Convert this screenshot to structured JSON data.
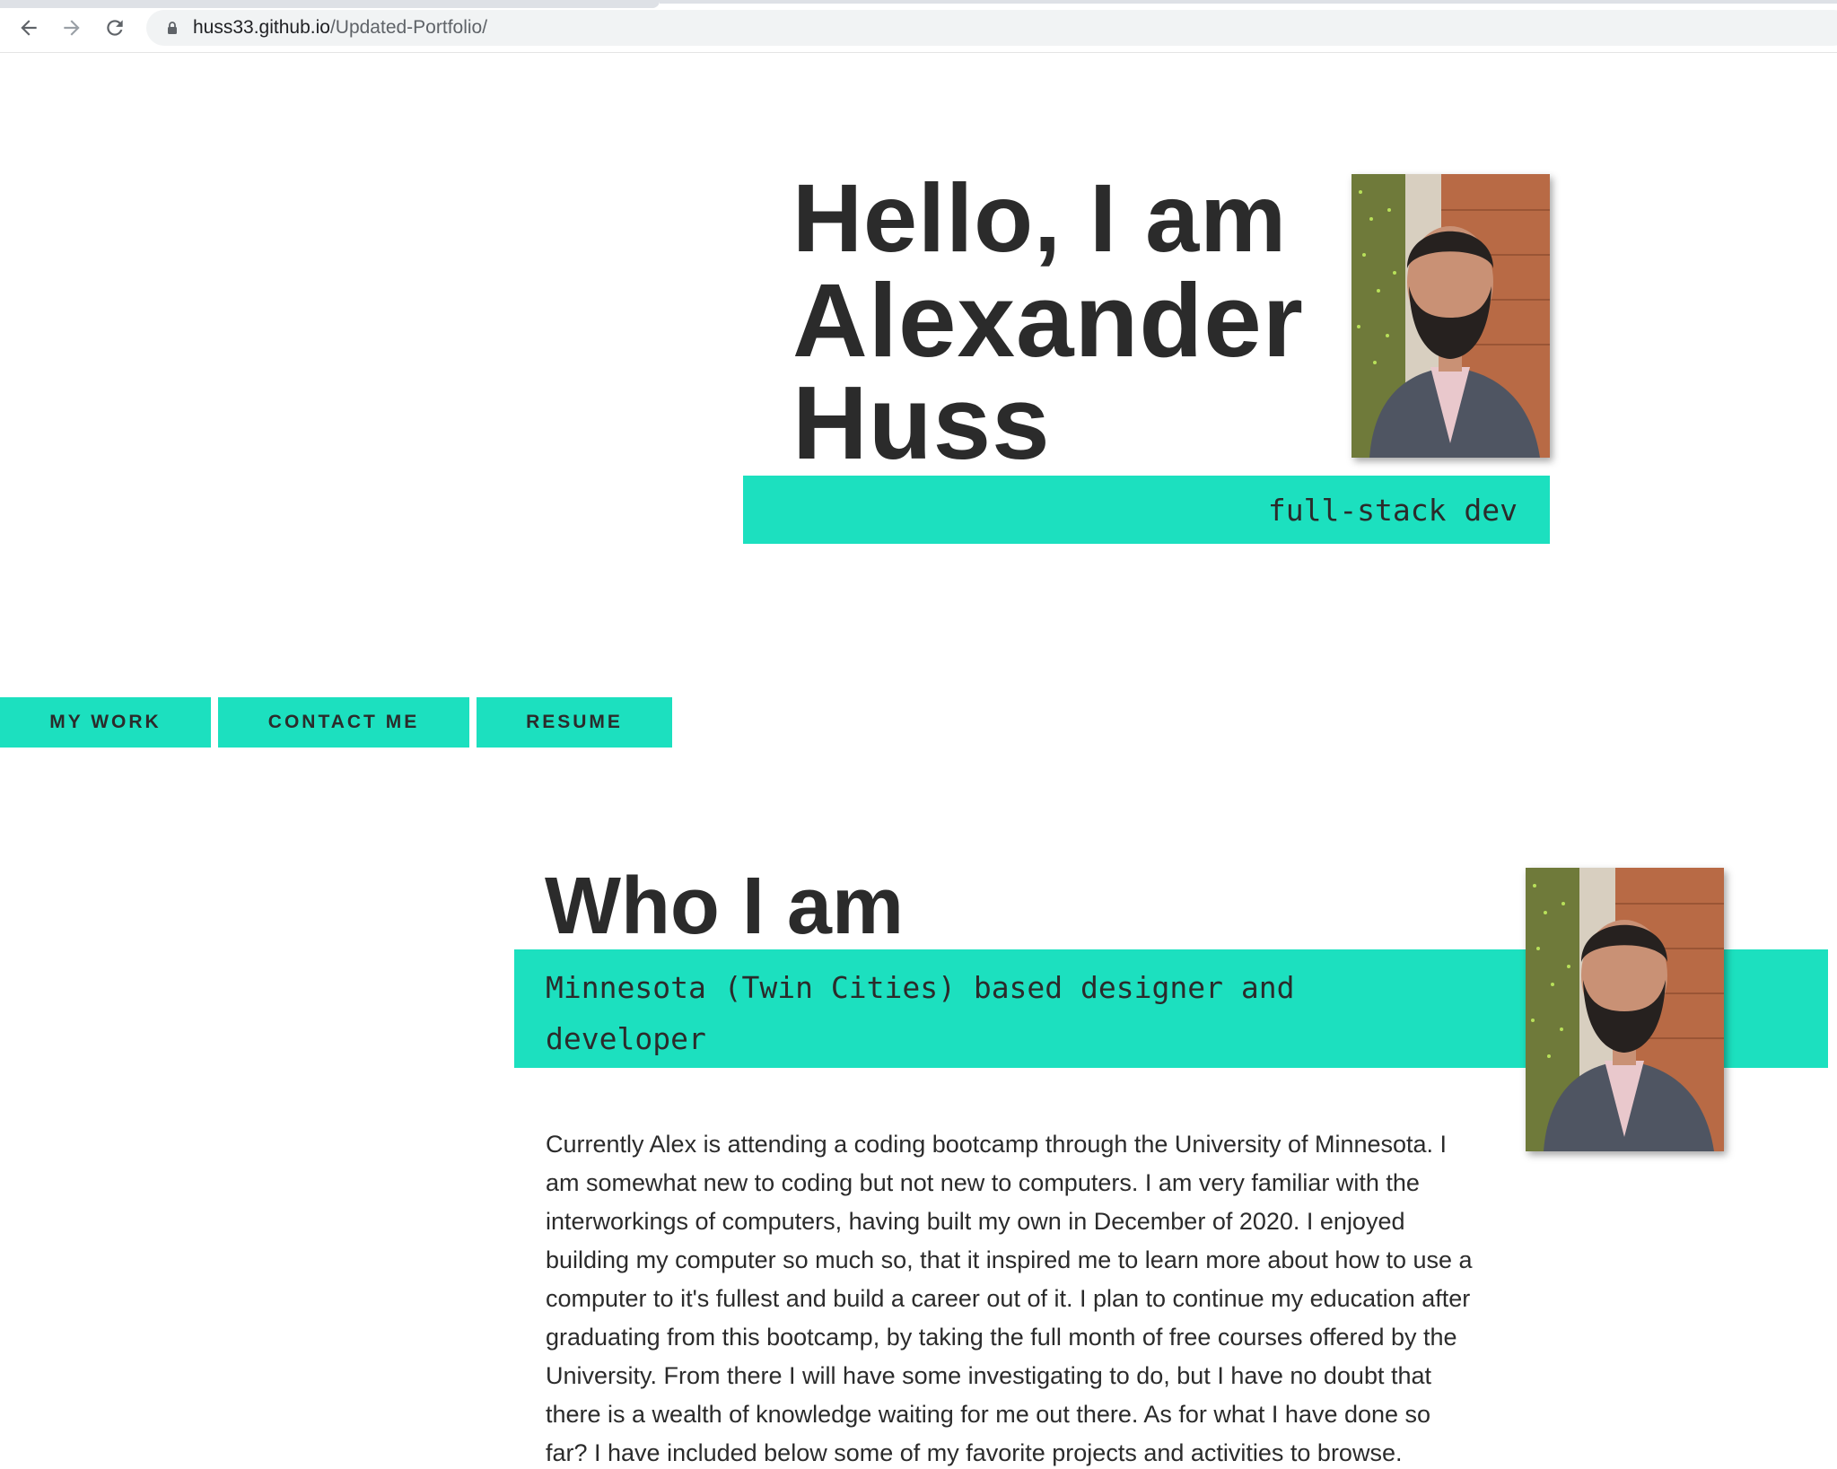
{
  "browser": {
    "url_host": "huss33.github.io",
    "url_path": "/Updated-Portfolio/"
  },
  "hero": {
    "title_line1": "Hello, I am",
    "title_line2": "Alexander",
    "title_line3": "Huss",
    "role": "full-stack dev"
  },
  "nav": {
    "items": [
      {
        "label": "MY WORK"
      },
      {
        "label": "CONTACT ME"
      },
      {
        "label": "RESUME"
      }
    ]
  },
  "about": {
    "title": "Who I am",
    "tagline": "Minnesota (Twin Cities) based designer and developer",
    "bio": "Currently Alex is attending a coding bootcamp through the University of Minnesota. I am somewhat new to coding but not new to computers. I am very familiar with the interworkings of computers, having built my own in December of 2020. I enjoyed building my computer so much so, that it inspired me to learn more about how to use a computer to it's fullest and build a career out of it. I plan to continue my education after graduating from this bootcamp, by taking the full month of free courses offered by the University. From there I will have some investigating to do, but I have no doubt that there is a wealth of knowledge waiting for me out there. As for what I have done so far? I have included below some of my favorite projects and activities to browse."
  },
  "colors": {
    "accent": "#1ce0bf",
    "text": "#2b2b2b"
  },
  "icons": [
    "back-arrow-icon",
    "forward-arrow-icon",
    "reload-icon",
    "lock-icon"
  ]
}
